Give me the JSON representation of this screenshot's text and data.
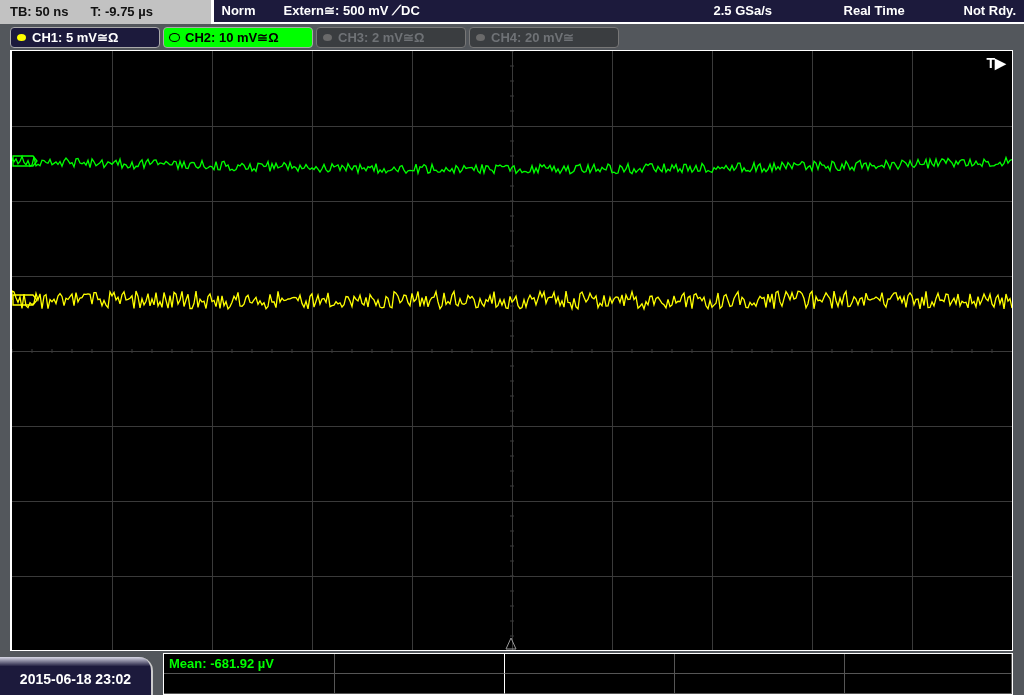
{
  "status_bar": {
    "timebase": "TB: 50 ns",
    "trigger_time": "T: -9.75 µs",
    "mode": "Norm",
    "trigger_source": "Extern≅: 500 mV ⟋DC",
    "sample_rate": "2.5 GSa/s",
    "acquisition": "Real Time",
    "state": "Not Rdy."
  },
  "channels": [
    {
      "label": "CH1: 5 mV≅Ω",
      "on": true,
      "selected": false,
      "color": "#ffff00"
    },
    {
      "label": "CH2: 10 mV≅Ω",
      "on": true,
      "selected": true,
      "color": "#00ff00"
    },
    {
      "label": "CH3: 2 mV≅Ω",
      "on": false,
      "selected": false,
      "color": "#6a6a6a"
    },
    {
      "label": "CH4: 20 mV≅",
      "on": false,
      "selected": false,
      "color": "#6a6a6a"
    }
  ],
  "trigger_marker": "T▶",
  "date_time": "2015-06-18 23:02",
  "measurements": [
    "Mean: -681.92 µV"
  ]
}
